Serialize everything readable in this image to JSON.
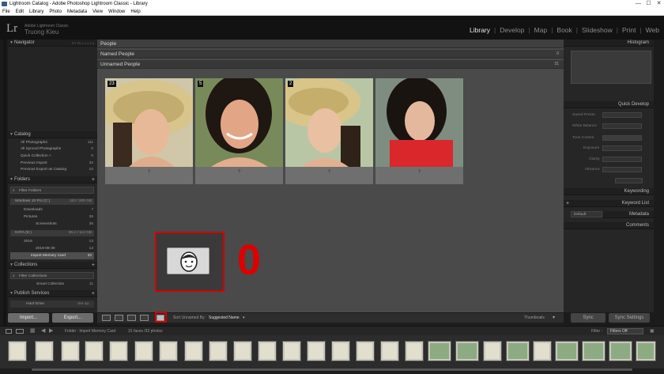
{
  "window": {
    "title": "Lightroom Catalog - Adobe Photoshop Lightroom Classic - Library",
    "controls": [
      "—",
      "☐",
      "✕"
    ]
  },
  "menu": [
    "File",
    "Edit",
    "Library",
    "Photo",
    "Metadata",
    "View",
    "Window",
    "Help"
  ],
  "identity": {
    "logo": "Lr",
    "product": "Adobe Lightroom Classic",
    "user": "Truong Kieu"
  },
  "modules": [
    "Library",
    "Develop",
    "Map",
    "Book",
    "Slideshow",
    "Print",
    "Web"
  ],
  "active_module": "Library",
  "left_panel": {
    "navigator": {
      "title": "Navigator",
      "zoom": "FIT   FILL   1:1   1:4"
    },
    "catalog": {
      "title": "Catalog",
      "items": [
        {
          "label": "All Photographs",
          "count": "111"
        },
        {
          "label": "All Synced Photographs",
          "count": "0"
        },
        {
          "label": "Quick Collection +",
          "count": "0"
        },
        {
          "label": "Previous Import",
          "count": "32"
        },
        {
          "label": "Previous Export as Catalog",
          "count": "10"
        }
      ]
    },
    "folders": {
      "title": "Folders",
      "filter": "Filter Folders",
      "volumes": [
        {
          "label": "Windows 10 Pro (C:)",
          "info": "110 / 200 GB"
        },
        {
          "label": "DATA (E:)",
          "info": "36.2 / 112 GB"
        }
      ],
      "items": [
        {
          "label": "Downloads",
          "count": "7"
        },
        {
          "label": "Pictures",
          "count": "36"
        },
        {
          "label": "Screenshots",
          "count": "36"
        },
        {
          "label": "2019",
          "count": "13"
        },
        {
          "label": "2019-08-30",
          "count": "13"
        },
        {
          "label": "Import Memory Card",
          "count": "32"
        }
      ]
    },
    "collections": {
      "title": "Collections",
      "filter": "Filter Collections",
      "items": [
        {
          "label": "Smart Collection",
          "count": "11"
        }
      ]
    },
    "publish": {
      "title": "Publish Services",
      "items": [
        {
          "label": "Hard Drive",
          "action": "Set up..."
        }
      ]
    },
    "import_label": "Import...",
    "export_label": "Export..."
  },
  "grid": {
    "header": "People",
    "named": {
      "label": "Named People",
      "count": "0"
    },
    "unnamed": {
      "label": "Unnamed People",
      "count": "31"
    },
    "cells": [
      {
        "badge": "23",
        "label": "?"
      },
      {
        "badge": "5",
        "label": "?"
      },
      {
        "badge": "2",
        "label": "?"
      },
      {
        "badge": "",
        "label": "?"
      }
    ],
    "callout_number": "0"
  },
  "toolbar": {
    "sort_label": "Sort Unnamed By:",
    "sort_value": "Suggested Name",
    "thumb_label": "Thumbnails"
  },
  "right_panel": {
    "histogram": "Histogram",
    "quick_develop": "Quick Develop",
    "qd_rows": [
      "Saved Preset",
      "White Balance",
      "Tone Control",
      "Exposure",
      "Clarity",
      "Vibrance"
    ],
    "keywording": "Keywording",
    "keyword_list": "Keyword List",
    "metadata": "Metadata",
    "metadata_default": "Default",
    "comments": "Comments",
    "sync_label": "Sync",
    "sync_settings_label": "Sync Settings"
  },
  "filmstrip": {
    "page_labels": [
      "1",
      "2"
    ],
    "source": "Folder : Import Memory Card",
    "count": "31 faces /32 photos",
    "filter_label": "Filter :",
    "filter_value": "Filters Off"
  }
}
